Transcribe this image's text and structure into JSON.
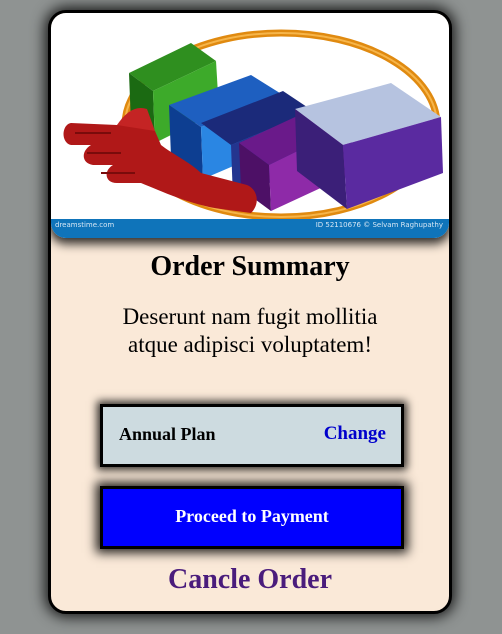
{
  "hero": {
    "image_name": "hand-holding-books-logo",
    "strip_left_text": "dreamstime.com",
    "strip_right_text": "ID 52110676 © Selvam Raghupathy"
  },
  "order": {
    "title": "Order Summary",
    "description": "Deserunt nam fugit mollitia atque adipisci voluptatem!"
  },
  "plan": {
    "name": "Annual Plan",
    "change_label": "Change"
  },
  "actions": {
    "pay_label": "Proceed to Payment",
    "cancel_label": "Cancle Order"
  },
  "colors": {
    "page_bg": "#8f9392",
    "card_bg": "#fae9d8",
    "plan_bg": "#cddbe0",
    "change_link": "#0000cc",
    "pay_button": "#0000ff",
    "cancel_link": "#4a1c7c"
  }
}
